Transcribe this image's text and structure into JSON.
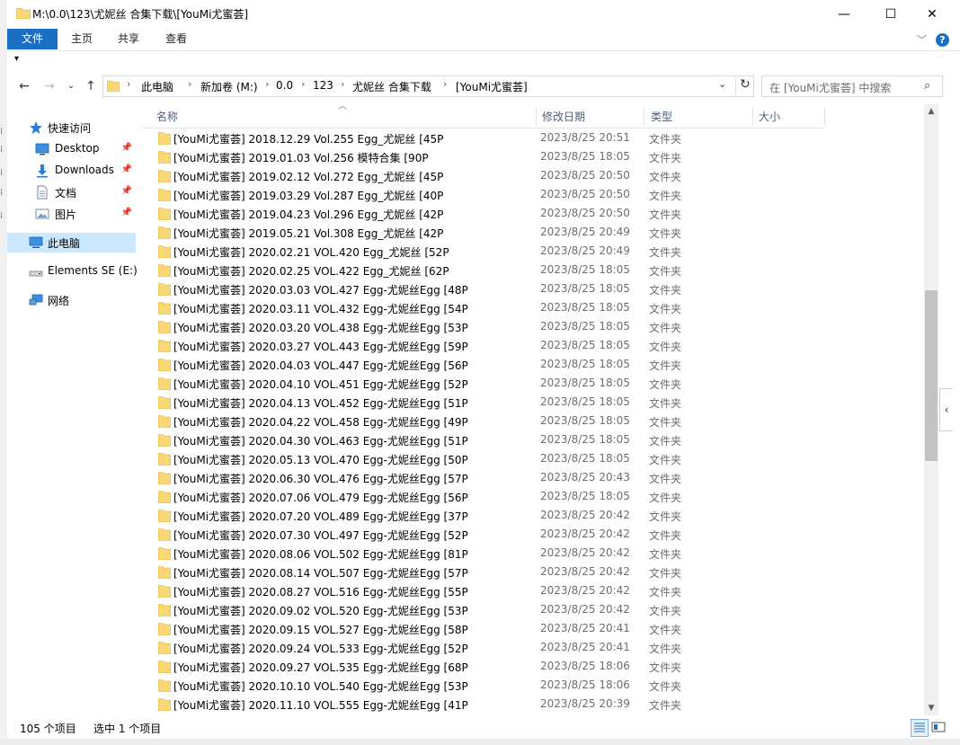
{
  "window": {
    "title": "M:\\0.0\\123\\尤妮丝 合集下载\\[YouMi尤蜜荟]",
    "minimize": "—",
    "maximize": "☐",
    "close": "✕"
  },
  "ribbon": {
    "tabs": [
      "文件",
      "主页",
      "共享",
      "查看"
    ],
    "help": "?"
  },
  "address": {
    "crumbs": [
      "此电脑",
      "新加卷 (M:)",
      "0.0",
      "123",
      "尤妮丝 合集下载",
      "[YouMi尤蜜荟]"
    ]
  },
  "search": {
    "placeholder": "在 [YouMi尤蜜荟] 中搜索"
  },
  "nav": {
    "items": [
      {
        "label": "快速访问",
        "icon": "star-icon"
      },
      {
        "label": "Desktop",
        "icon": "desktop-icon"
      },
      {
        "label": "Downloads",
        "icon": "download-icon"
      },
      {
        "label": "文档",
        "icon": "document-icon"
      },
      {
        "label": "图片",
        "icon": "picture-icon"
      },
      {
        "label": "此电脑",
        "icon": "computer-icon"
      },
      {
        "label": "Elements SE (E:)",
        "icon": "drive-icon"
      },
      {
        "label": "网络",
        "icon": "network-icon"
      }
    ]
  },
  "columns": {
    "name": "名称",
    "date": "修改日期",
    "type": "类型",
    "size": "大小"
  },
  "files": [
    {
      "name": "[YouMi尤蜜荟] 2018.12.29 Vol.255 Egg_尤妮丝 [45P",
      "date": "2023/8/25 20:51",
      "type": "文件夹"
    },
    {
      "name": "[YouMi尤蜜荟] 2019.01.03 Vol.256 模特合集 [90P",
      "date": "2023/8/25 18:05",
      "type": "文件夹"
    },
    {
      "name": "[YouMi尤蜜荟] 2019.02.12 Vol.272 Egg_尤妮丝 [45P",
      "date": "2023/8/25 20:50",
      "type": "文件夹"
    },
    {
      "name": "[YouMi尤蜜荟] 2019.03.29 Vol.287 Egg_尤妮丝 [40P",
      "date": "2023/8/25 20:50",
      "type": "文件夹"
    },
    {
      "name": "[YouMi尤蜜荟] 2019.04.23 Vol.296 Egg_尤妮丝 [42P",
      "date": "2023/8/25 20:50",
      "type": "文件夹"
    },
    {
      "name": "[YouMi尤蜜荟] 2019.05.21 Vol.308 Egg_尤妮丝 [42P",
      "date": "2023/8/25 20:49",
      "type": "文件夹"
    },
    {
      "name": "[YouMi尤蜜荟] 2020.02.21 VOL.420 Egg_尤妮丝 [52P",
      "date": "2023/8/25 20:49",
      "type": "文件夹"
    },
    {
      "name": "[YouMi尤蜜荟] 2020.02.25 VOL.422 Egg_尤妮丝 [62P",
      "date": "2023/8/25 18:05",
      "type": "文件夹"
    },
    {
      "name": "[YouMi尤蜜荟] 2020.03.03 VOL.427 Egg-尤妮丝Egg [48P",
      "date": "2023/8/25 18:05",
      "type": "文件夹"
    },
    {
      "name": "[YouMi尤蜜荟] 2020.03.11 VOL.432 Egg-尤妮丝Egg [54P",
      "date": "2023/8/25 18:05",
      "type": "文件夹"
    },
    {
      "name": "[YouMi尤蜜荟] 2020.03.20 VOL.438 Egg-尤妮丝Egg [53P",
      "date": "2023/8/25 18:05",
      "type": "文件夹"
    },
    {
      "name": "[YouMi尤蜜荟] 2020.03.27 VOL.443 Egg-尤妮丝Egg [59P",
      "date": "2023/8/25 18:05",
      "type": "文件夹"
    },
    {
      "name": "[YouMi尤蜜荟] 2020.04.03 VOL.447 Egg-尤妮丝Egg [56P",
      "date": "2023/8/25 18:05",
      "type": "文件夹"
    },
    {
      "name": "[YouMi尤蜜荟] 2020.04.10 VOL.451 Egg-尤妮丝Egg [52P",
      "date": "2023/8/25 18:05",
      "type": "文件夹"
    },
    {
      "name": "[YouMi尤蜜荟] 2020.04.13 VOL.452 Egg-尤妮丝Egg [51P",
      "date": "2023/8/25 18:05",
      "type": "文件夹"
    },
    {
      "name": "[YouMi尤蜜荟] 2020.04.22 VOL.458 Egg-尤妮丝Egg [49P",
      "date": "2023/8/25 18:05",
      "type": "文件夹"
    },
    {
      "name": "[YouMi尤蜜荟] 2020.04.30 VOL.463 Egg-尤妮丝Egg [51P",
      "date": "2023/8/25 18:05",
      "type": "文件夹"
    },
    {
      "name": "[YouMi尤蜜荟] 2020.05.13 VOL.470 Egg-尤妮丝Egg [50P",
      "date": "2023/8/25 18:05",
      "type": "文件夹"
    },
    {
      "name": "[YouMi尤蜜荟] 2020.06.30 VOL.476 Egg-尤妮丝Egg [57P",
      "date": "2023/8/25 20:43",
      "type": "文件夹"
    },
    {
      "name": "[YouMi尤蜜荟] 2020.07.06 VOL.479 Egg-尤妮丝Egg [56P",
      "date": "2023/8/25 18:05",
      "type": "文件夹"
    },
    {
      "name": "[YouMi尤蜜荟] 2020.07.20 VOL.489 Egg-尤妮丝Egg [37P",
      "date": "2023/8/25 20:42",
      "type": "文件夹"
    },
    {
      "name": "[YouMi尤蜜荟] 2020.07.30 VOL.497 Egg-尤妮丝Egg [52P",
      "date": "2023/8/25 20:42",
      "type": "文件夹"
    },
    {
      "name": "[YouMi尤蜜荟] 2020.08.06 VOL.502 Egg-尤妮丝Egg [81P",
      "date": "2023/8/25 20:42",
      "type": "文件夹"
    },
    {
      "name": "[YouMi尤蜜荟] 2020.08.14 VOL.507 Egg-尤妮丝Egg [57P",
      "date": "2023/8/25 20:42",
      "type": "文件夹"
    },
    {
      "name": "[YouMi尤蜜荟] 2020.08.27 VOL.516 Egg-尤妮丝Egg [55P",
      "date": "2023/8/25 20:42",
      "type": "文件夹"
    },
    {
      "name": "[YouMi尤蜜荟] 2020.09.02 VOL.520 Egg-尤妮丝Egg [53P",
      "date": "2023/8/25 20:42",
      "type": "文件夹"
    },
    {
      "name": "[YouMi尤蜜荟] 2020.09.15 VOL.527 Egg-尤妮丝Egg [58P",
      "date": "2023/8/25 20:41",
      "type": "文件夹"
    },
    {
      "name": "[YouMi尤蜜荟] 2020.09.24 VOL.533 Egg-尤妮丝Egg [52P",
      "date": "2023/8/25 20:41",
      "type": "文件夹"
    },
    {
      "name": "[YouMi尤蜜荟] 2020.09.27 VOL.535 Egg-尤妮丝Egg [68P",
      "date": "2023/8/25 18:06",
      "type": "文件夹"
    },
    {
      "name": "[YouMi尤蜜荟] 2020.10.10 VOL.540 Egg-尤妮丝Egg [53P",
      "date": "2023/8/25 18:06",
      "type": "文件夹"
    },
    {
      "name": "[YouMi尤蜜荟] 2020.11.10 VOL.555 Egg-尤妮丝Egg [41P",
      "date": "2023/8/25 20:39",
      "type": "文件夹"
    }
  ],
  "status": {
    "count": "105 个项目",
    "selected": "选中 1 个项目"
  },
  "colors": {
    "accent": "#1a6fc3",
    "selected_nav": "#cce8ff",
    "folder": "#f8d775"
  }
}
